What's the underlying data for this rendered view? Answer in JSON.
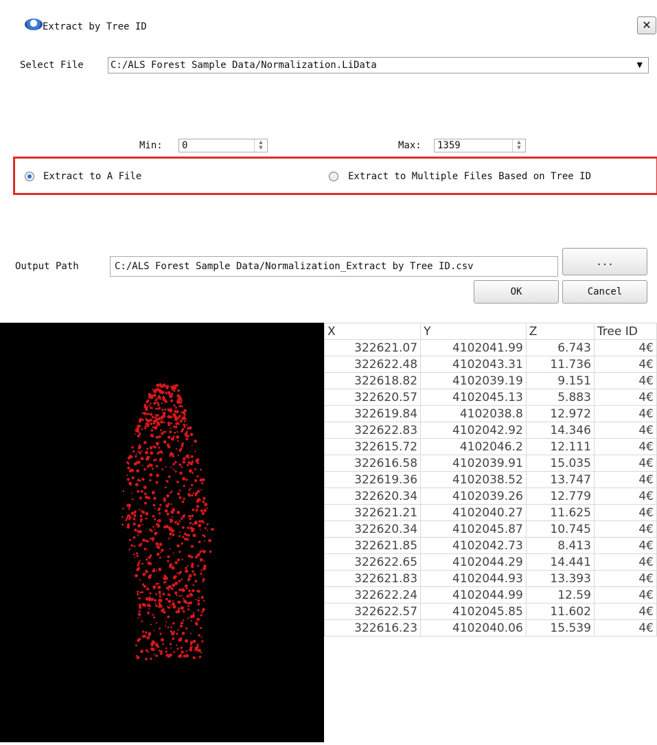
{
  "dialog": {
    "title": "Extract by Tree ID",
    "close_label": "✕",
    "select_file_label": "Select File",
    "select_file_value": "C:/ALS Forest Sample Data/Normalization.LiData",
    "min_label": "Min:",
    "min_value": "0",
    "max_label": "Max:",
    "max_value": "1359",
    "radio_single_label": "Extract to A File",
    "radio_multiple_label": "Extract to Multiple Files Based on Tree ID",
    "output_path_label": "Output Path",
    "output_path_value": "C:/ALS Forest Sample Data/Normalization_Extract by Tree ID.csv",
    "browse_label": "...",
    "ok_label": "OK",
    "cancel_label": "Cancel"
  },
  "table": {
    "headers": [
      "X",
      "Y",
      "Z",
      "Tree ID"
    ],
    "rows": [
      [
        "322621.07",
        "4102041.99",
        "6.743",
        "4€"
      ],
      [
        "322622.48",
        "4102043.31",
        "11.736",
        "4€"
      ],
      [
        "322618.82",
        "4102039.19",
        "9.151",
        "4€"
      ],
      [
        "322620.57",
        "4102045.13",
        "5.883",
        "4€"
      ],
      [
        "322619.84",
        "4102038.8",
        "12.972",
        "4€"
      ],
      [
        "322622.83",
        "4102042.92",
        "14.346",
        "4€"
      ],
      [
        "322615.72",
        "4102046.2",
        "12.111",
        "4€"
      ],
      [
        "322616.58",
        "4102039.91",
        "15.035",
        "4€"
      ],
      [
        "322619.36",
        "4102038.52",
        "13.747",
        "4€"
      ],
      [
        "322620.34",
        "4102039.26",
        "12.779",
        "4€"
      ],
      [
        "322621.21",
        "4102040.27",
        "11.625",
        "4€"
      ],
      [
        "322620.34",
        "4102045.87",
        "10.745",
        "4€"
      ],
      [
        "322621.85",
        "4102042.73",
        "8.413",
        "4€"
      ],
      [
        "322622.65",
        "4102044.29",
        "14.441",
        "4€"
      ],
      [
        "322621.83",
        "4102044.93",
        "13.393",
        "4€"
      ],
      [
        "322622.24",
        "4102044.99",
        "12.59",
        "4€"
      ],
      [
        "322622.57",
        "4102045.85",
        "11.602",
        "4€"
      ],
      [
        "322616.23",
        "4102040.06",
        "15.539",
        "4€"
      ]
    ]
  },
  "colors": {
    "highlight_box": "#e22b2b",
    "point_cloud": "#d4181c",
    "viewer_background": "#000000"
  }
}
